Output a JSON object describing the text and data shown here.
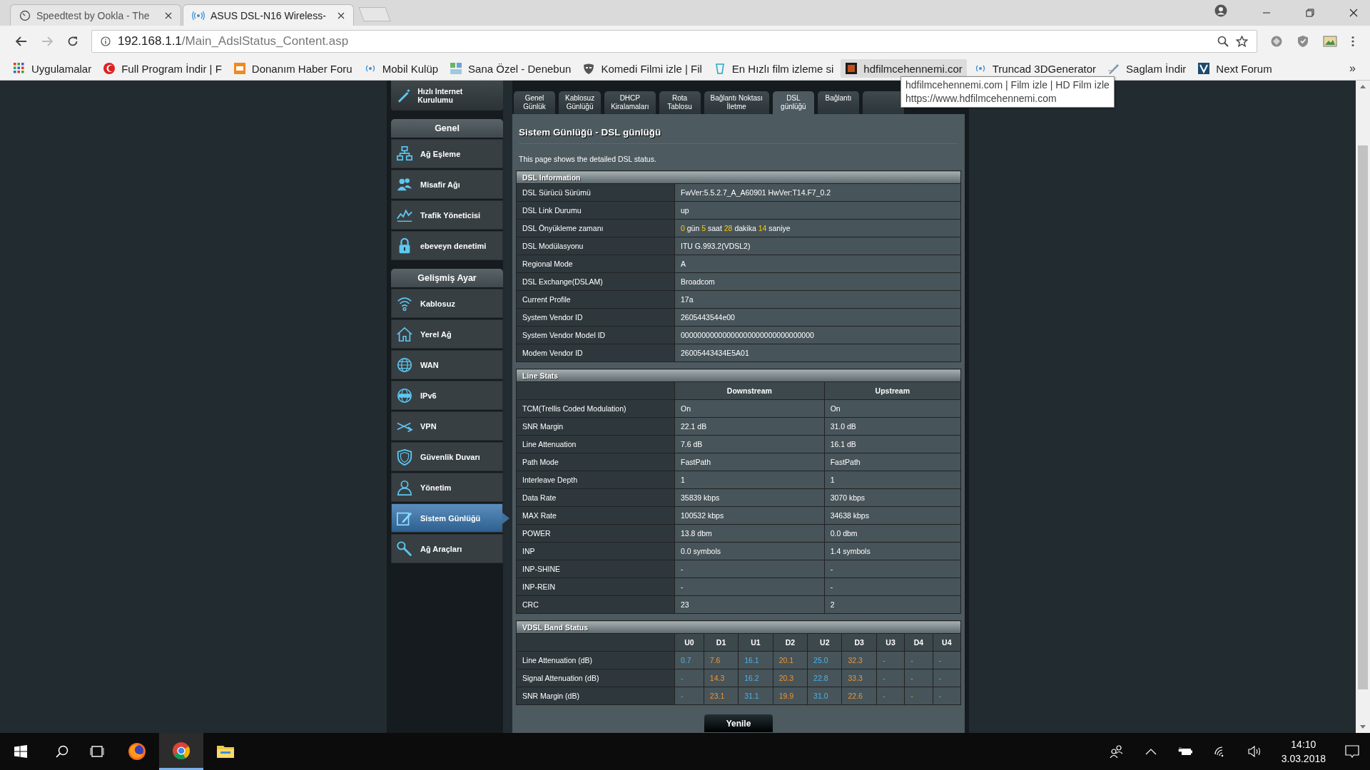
{
  "browser": {
    "tabs": [
      {
        "title": "Speedtest by Ookla - The",
        "selected": false
      },
      {
        "title": "ASUS DSL-N16 Wireless-",
        "selected": true
      }
    ],
    "host": "192.168.1.1",
    "path": "/Main_AdslStatus_Content.asp",
    "bookmarks": [
      {
        "label": "Uygulamalar",
        "hovered": false
      },
      {
        "label": "Full Program İndir | F",
        "hovered": false
      },
      {
        "label": "Donanım Haber Foru",
        "hovered": false
      },
      {
        "label": "Mobil Kulüp",
        "hovered": false
      },
      {
        "label": "Sana Özel - Denebun",
        "hovered": false
      },
      {
        "label": "Komedi Filmi izle | Fil",
        "hovered": false
      },
      {
        "label": "En Hızlı film izleme si",
        "hovered": false
      },
      {
        "label": "hdfilmcehennemi.cor",
        "hovered": true
      },
      {
        "label": "Truncad 3DGenerator",
        "hovered": false
      },
      {
        "label": "Saglam İndir",
        "hovered": false
      },
      {
        "label": "Next Forum",
        "hovered": false
      }
    ],
    "more": "»",
    "tooltip": {
      "title": "hdfilmcehennemi.com | Film izle | HD Film izle",
      "url": "https://www.hdfilmcehennemi.com"
    }
  },
  "sidebar": {
    "top_item": "Hızlı Internet Kurulumu",
    "sections": [
      {
        "title": "Genel",
        "items": [
          {
            "label": "Ağ Eşleme",
            "selected": false
          },
          {
            "label": "Misafir Ağı",
            "selected": false
          },
          {
            "label": "Trafik Yöneticisi",
            "selected": false
          },
          {
            "label": "ebeveyn denetimi",
            "selected": false
          }
        ]
      },
      {
        "title": "Gelişmiş Ayar",
        "items": [
          {
            "label": "Kablosuz",
            "selected": false
          },
          {
            "label": "Yerel Ağ",
            "selected": false
          },
          {
            "label": "WAN",
            "selected": false
          },
          {
            "label": "IPv6",
            "selected": false
          },
          {
            "label": "VPN",
            "selected": false
          },
          {
            "label": "Güvenlik Duvarı",
            "selected": false
          },
          {
            "label": "Yönetim",
            "selected": false
          },
          {
            "label": "Sistem Günlüğü",
            "selected": true
          },
          {
            "label": "Ağ Araçları",
            "selected": false
          }
        ]
      }
    ]
  },
  "tabs": [
    {
      "label": "Genel\nGünlük",
      "selected": false
    },
    {
      "label": "Kablosuz\nGünlüğü",
      "selected": false
    },
    {
      "label": "DHCP\nKiralamaları",
      "selected": false
    },
    {
      "label": "Rota\nTablosu",
      "selected": false
    },
    {
      "label": "Bağlantı Noktası\nİletme",
      "selected": false
    },
    {
      "label": "DSL\ngünlüğü",
      "selected": true
    },
    {
      "label": "Bağlantı",
      "selected": false
    },
    {
      "selected": false
    }
  ],
  "page": {
    "title": "Sistem Günlüğü - DSL günlüğü",
    "description": "This page shows the detailed DSL status."
  },
  "dsl_information": {
    "title": "DSL Information",
    "rows": [
      {
        "label": "DSL Sürücü Sürümü",
        "value": "FwVer:5.5.2.7_A_A60901 HwVer:T14.F7_0.2"
      },
      {
        "label": "DSL Link Durumu",
        "value": "up"
      },
      {
        "label": "DSL Önyükleme zamanı",
        "value_parts": [
          {
            "text": "0",
            "kind": "number"
          },
          {
            "text": "gün",
            "kind": "unit"
          },
          {
            "text": "5",
            "kind": "number"
          },
          {
            "text": "saat",
            "kind": "unit"
          },
          {
            "text": "28",
            "kind": "number"
          },
          {
            "text": "dakika",
            "kind": "unit"
          },
          {
            "text": "14",
            "kind": "number"
          },
          {
            "text": "saniye",
            "kind": "unit"
          }
        ]
      },
      {
        "label": "DSL Modülasyonu",
        "value": "ITU G.993.2(VDSL2)"
      },
      {
        "label": "Regional Mode",
        "value": "A"
      },
      {
        "label": "DSL Exchange(DSLAM)",
        "value": "Broadcom"
      },
      {
        "label": "Current Profile",
        "value": "17a"
      },
      {
        "label": "System Vendor ID",
        "value": "2605443544e00"
      },
      {
        "label": "System Vendor Model ID",
        "value": "00000000000000000000000000000000"
      },
      {
        "label": "Modem Vendor ID",
        "value": "26005443434E5A01"
      }
    ]
  },
  "line_stats": {
    "title": "Line Stats",
    "columns": [
      "Downstream",
      "Upstream"
    ],
    "rows": [
      {
        "label": "TCM(Trellis Coded Modulation)",
        "values": [
          "On",
          "On"
        ]
      },
      {
        "label": "SNR Margin",
        "values": [
          "22.1 dB",
          "31.0 dB"
        ]
      },
      {
        "label": "Line Attenuation",
        "values": [
          "7.6 dB",
          "16.1 dB"
        ]
      },
      {
        "label": "Path Mode",
        "values": [
          "FastPath",
          "FastPath"
        ]
      },
      {
        "label": "Interleave Depth",
        "values": [
          "1",
          "1"
        ]
      },
      {
        "label": "Data Rate",
        "values": [
          "35839 kbps",
          "3070 kbps"
        ]
      },
      {
        "label": "MAX Rate",
        "values": [
          "100532 kbps",
          "34638 kbps"
        ]
      },
      {
        "label": "POWER",
        "values": [
          "13.8 dbm",
          "0.0 dbm"
        ]
      },
      {
        "label": "INP",
        "values": [
          "0.0 symbols",
          "1.4 symbols"
        ]
      },
      {
        "label": "INP-SHINE",
        "values": [
          "-",
          "-"
        ]
      },
      {
        "label": "INP-REIN",
        "values": [
          "-",
          "-"
        ]
      },
      {
        "label": "CRC",
        "values": [
          "23",
          "2"
        ]
      }
    ]
  },
  "vdsl_band_status": {
    "title": "VDSL Band Status",
    "columns": [
      {
        "label": "U0",
        "kind": "up"
      },
      {
        "label": "D1",
        "kind": "down"
      },
      {
        "label": "U1",
        "kind": "up"
      },
      {
        "label": "D2",
        "kind": "down"
      },
      {
        "label": "U2",
        "kind": "up"
      },
      {
        "label": "D3",
        "kind": "down"
      },
      {
        "label": "U3",
        "kind": "up"
      },
      {
        "label": "D4",
        "kind": "down"
      },
      {
        "label": "U4",
        "kind": "up"
      }
    ],
    "rows": [
      {
        "label": "Line Attenuation (dB)",
        "values": [
          "0.7",
          "7.6",
          "16.1",
          "20.1",
          "25.0",
          "32.3",
          "-",
          "-",
          "-"
        ]
      },
      {
        "label": "Signal Attenuation (dB)",
        "values": [
          "-",
          "14.3",
          "16.2",
          "20.3",
          "22.8",
          "33.3",
          "-",
          "-",
          "-"
        ]
      },
      {
        "label": "SNR Margin (dB)",
        "values": [
          "-",
          "23.1",
          "31.1",
          "19.9",
          "31.0",
          "22.6",
          "-",
          "-",
          "-"
        ]
      }
    ]
  },
  "refresh_button": "Yenile",
  "taskbar": {
    "apps": [
      {
        "kind": "firefox",
        "active": false
      },
      {
        "kind": "chrome",
        "active": true
      },
      {
        "kind": "files",
        "active": false
      }
    ],
    "time": "14:10",
    "date": "3.03.2018"
  }
}
